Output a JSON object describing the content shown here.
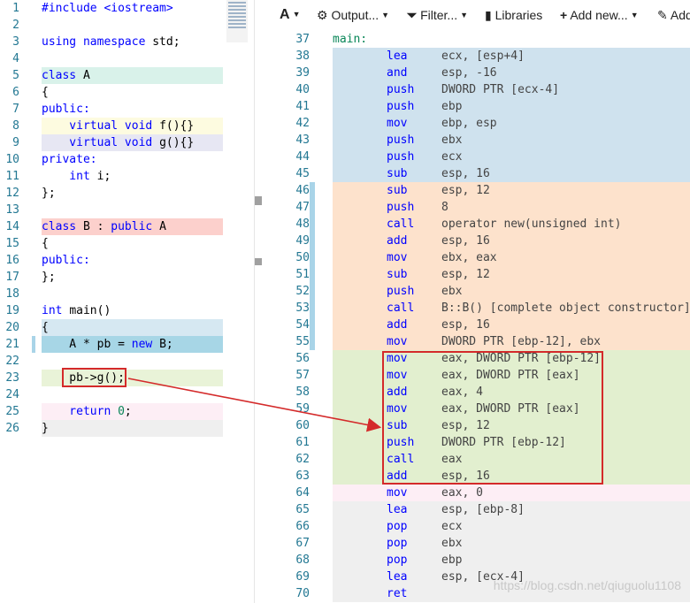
{
  "source": {
    "lines": [
      {
        "n": "1",
        "segs": [
          {
            "t": "#include <iostream>",
            "c": "kw"
          }
        ]
      },
      {
        "n": "2",
        "segs": []
      },
      {
        "n": "3",
        "segs": [
          {
            "t": "using namespace ",
            "c": "kw"
          },
          {
            "t": "std;",
            "c": ""
          }
        ]
      },
      {
        "n": "4",
        "segs": []
      },
      {
        "n": "5",
        "segs": [
          {
            "t": "class ",
            "c": "kw"
          },
          {
            "t": "A",
            "c": ""
          }
        ],
        "hl": "#d9f2ea"
      },
      {
        "n": "6",
        "segs": [
          {
            "t": "{",
            "c": ""
          }
        ]
      },
      {
        "n": "7",
        "segs": [
          {
            "t": "public:",
            "c": "kw"
          }
        ]
      },
      {
        "n": "8",
        "segs": [
          {
            "t": "    virtual void ",
            "c": "kw"
          },
          {
            "t": "f(){}",
            "c": ""
          }
        ],
        "hl": "#fdfbe0"
      },
      {
        "n": "9",
        "segs": [
          {
            "t": "    virtual void ",
            "c": "kw"
          },
          {
            "t": "g(){}",
            "c": ""
          }
        ],
        "hl": "#e7e7f3"
      },
      {
        "n": "10",
        "segs": [
          {
            "t": "private:",
            "c": "kw"
          }
        ]
      },
      {
        "n": "11",
        "segs": [
          {
            "t": "    int ",
            "c": "kw"
          },
          {
            "t": "i;",
            "c": ""
          }
        ]
      },
      {
        "n": "12",
        "segs": [
          {
            "t": "};",
            "c": ""
          }
        ]
      },
      {
        "n": "13",
        "segs": []
      },
      {
        "n": "14",
        "segs": [
          {
            "t": "class ",
            "c": "kw"
          },
          {
            "t": "B : ",
            "c": ""
          },
          {
            "t": "public ",
            "c": "kw"
          },
          {
            "t": "A",
            "c": ""
          }
        ],
        "hl": "#fcd0cc"
      },
      {
        "n": "15",
        "segs": [
          {
            "t": "{",
            "c": ""
          }
        ]
      },
      {
        "n": "16",
        "segs": [
          {
            "t": "public:",
            "c": "kw"
          }
        ]
      },
      {
        "n": "17",
        "segs": [
          {
            "t": "};",
            "c": ""
          }
        ]
      },
      {
        "n": "18",
        "segs": []
      },
      {
        "n": "19",
        "segs": [
          {
            "t": "int ",
            "c": "kw"
          },
          {
            "t": "main()",
            "c": ""
          }
        ]
      },
      {
        "n": "20",
        "segs": [
          {
            "t": "{",
            "c": ""
          }
        ],
        "hl": "#d6e8f2"
      },
      {
        "n": "21",
        "segs": [
          {
            "t": "    A * pb = ",
            "c": ""
          },
          {
            "t": "new ",
            "c": "kw"
          },
          {
            "t": "B;",
            "c": ""
          }
        ],
        "hl": "#a7d6e6",
        "mark": true
      },
      {
        "n": "22",
        "segs": []
      },
      {
        "n": "23",
        "segs": [
          {
            "t": "    pb->g();",
            "c": ""
          }
        ],
        "hl": "#e9f3d8"
      },
      {
        "n": "24",
        "segs": []
      },
      {
        "n": "25",
        "segs": [
          {
            "t": "    return ",
            "c": "kw"
          },
          {
            "t": "0",
            "c": "num"
          },
          {
            "t": ";",
            "c": ""
          }
        ],
        "hl": "#fdeef5"
      },
      {
        "n": "26",
        "segs": [
          {
            "t": "}",
            "c": ""
          }
        ],
        "hl": "#efefef"
      }
    ]
  },
  "toolbar": {
    "font_icon": "A",
    "output_label": "Output...",
    "filter_label": "Filter...",
    "libraries_label": "Libraries",
    "add_new_label": "Add new...",
    "add_label": "Add"
  },
  "asm": {
    "lines": [
      {
        "n": "37",
        "label": "main:",
        "bg": "#ffffff"
      },
      {
        "n": "38",
        "op": "lea",
        "args": "ecx, [esp+4]",
        "bg": "#cfe2ee"
      },
      {
        "n": "39",
        "op": "and",
        "args": "esp, -16",
        "bg": "#cfe2ee"
      },
      {
        "n": "40",
        "op": "push",
        "args": "DWORD PTR [ecx-4]",
        "bg": "#cfe2ee"
      },
      {
        "n": "41",
        "op": "push",
        "args": "ebp",
        "bg": "#cfe2ee"
      },
      {
        "n": "42",
        "op": "mov",
        "args": "ebp, esp",
        "bg": "#cfe2ee"
      },
      {
        "n": "43",
        "op": "push",
        "args": "ebx",
        "bg": "#cfe2ee"
      },
      {
        "n": "44",
        "op": "push",
        "args": "ecx",
        "bg": "#cfe2ee"
      },
      {
        "n": "45",
        "op": "sub",
        "args": "esp, 16",
        "bg": "#cfe2ee"
      },
      {
        "n": "46",
        "op": "sub",
        "args": "esp, 12",
        "bg": "#fde2cc",
        "gut": true
      },
      {
        "n": "47",
        "op": "push",
        "args": "8",
        "bg": "#fde2cc",
        "gut": true
      },
      {
        "n": "48",
        "op": "call",
        "args": "operator new(unsigned int)",
        "bg": "#fde2cc",
        "gut": true
      },
      {
        "n": "49",
        "op": "add",
        "args": "esp, 16",
        "bg": "#fde2cc",
        "gut": true
      },
      {
        "n": "50",
        "op": "mov",
        "args": "ebx, eax",
        "bg": "#fde2cc",
        "gut": true
      },
      {
        "n": "51",
        "op": "sub",
        "args": "esp, 12",
        "bg": "#fde2cc",
        "gut": true
      },
      {
        "n": "52",
        "op": "push",
        "args": "ebx",
        "bg": "#fde2cc",
        "gut": true
      },
      {
        "n": "53",
        "op": "call",
        "args": "B::B() [complete object constructor]",
        "bg": "#fde2cc",
        "gut": true
      },
      {
        "n": "54",
        "op": "add",
        "args": "esp, 16",
        "bg": "#fde2cc",
        "gut": true
      },
      {
        "n": "55",
        "op": "mov",
        "args": "DWORD PTR [ebp-12], ebx",
        "bg": "#fde2cc",
        "gut": true
      },
      {
        "n": "56",
        "op": "mov",
        "args": "eax, DWORD PTR [ebp-12]",
        "bg": "#e2efcf"
      },
      {
        "n": "57",
        "op": "mov",
        "args": "eax, DWORD PTR [eax]",
        "bg": "#e2efcf"
      },
      {
        "n": "58",
        "op": "add",
        "args": "eax, 4",
        "bg": "#e2efcf"
      },
      {
        "n": "59",
        "op": "mov",
        "args": "eax, DWORD PTR [eax]",
        "bg": "#e2efcf"
      },
      {
        "n": "60",
        "op": "sub",
        "args": "esp, 12",
        "bg": "#e2efcf"
      },
      {
        "n": "61",
        "op": "push",
        "args": "DWORD PTR [ebp-12]",
        "bg": "#e2efcf"
      },
      {
        "n": "62",
        "op": "call",
        "args": "eax",
        "bg": "#e2efcf"
      },
      {
        "n": "63",
        "op": "add",
        "args": "esp, 16",
        "bg": "#e2efcf"
      },
      {
        "n": "64",
        "op": "mov",
        "args": "eax, 0",
        "bg": "#fdeef5"
      },
      {
        "n": "65",
        "op": "lea",
        "args": "esp, [ebp-8]",
        "bg": "#efefef"
      },
      {
        "n": "66",
        "op": "pop",
        "args": "ecx",
        "bg": "#efefef"
      },
      {
        "n": "67",
        "op": "pop",
        "args": "ebx",
        "bg": "#efefef"
      },
      {
        "n": "68",
        "op": "pop",
        "args": "ebp",
        "bg": "#efefef"
      },
      {
        "n": "69",
        "op": "lea",
        "args": "esp, [ecx-4]",
        "bg": "#efefef"
      },
      {
        "n": "70",
        "op": "ret",
        "args": "",
        "bg": "#efefef"
      }
    ]
  },
  "watermark": "https://blog.csdn.net/qiuguolu1108",
  "colors": {
    "annotation": "#d42a2a",
    "line_number": "#237893",
    "keyword": "#0000ff",
    "number": "#098658"
  }
}
